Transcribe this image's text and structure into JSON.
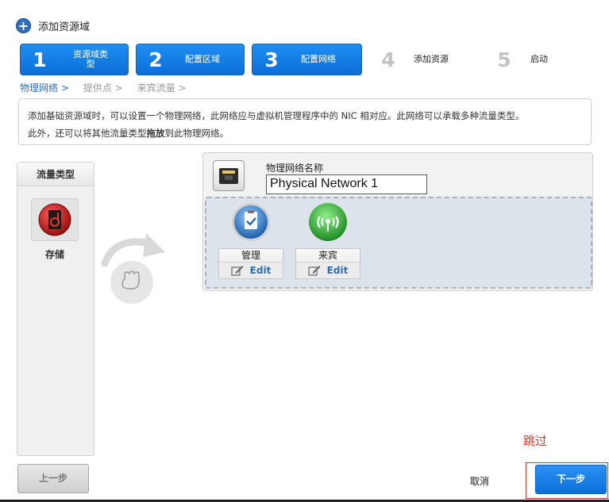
{
  "dialog": {
    "title": "添加资源域"
  },
  "steps": [
    {
      "num": "1",
      "label": "资源域类型",
      "label_line1": "资源域类",
      "label_line2": "型",
      "active": true
    },
    {
      "num": "2",
      "label": "配置区域",
      "active": true
    },
    {
      "num": "3",
      "label": "配置网络",
      "active": true
    },
    {
      "num": "4",
      "label": "添加资源",
      "active": false
    },
    {
      "num": "5",
      "label": "启动",
      "active": false
    }
  ],
  "breadcrumb": [
    {
      "label": "物理网络 >",
      "current": true
    },
    {
      "label": "提供点 >",
      "current": false
    },
    {
      "label": "来宾流量 >",
      "current": false
    }
  ],
  "info": {
    "line1": "添加基础资源域时，可以设置一个物理网络，此网络应与虚拟机管理程序中的 NIC 相对应。此网络可以承载多种流量类型。",
    "line2_prefix": "此外，还可以将其他流量类型",
    "line2_bold": "拖放",
    "line2_suffix": "到此物理网络。"
  },
  "traffic_panel": {
    "header": "流量类型",
    "items": [
      {
        "label": "存储",
        "icon": "storage-icon"
      }
    ]
  },
  "network": {
    "name_label": "物理网络名称",
    "name_value": "Physical Network 1",
    "traffic_types": [
      {
        "label": "管理",
        "edit": "Edit",
        "icon": "management-icon"
      },
      {
        "label": "来宾",
        "edit": "Edit",
        "icon": "guest-icon"
      }
    ]
  },
  "footer": {
    "skip": "跳过",
    "prev": "上一步",
    "cancel": "取消",
    "next": "下一步"
  },
  "colors": {
    "accent": "#0a6fd6",
    "skip": "#e0322a",
    "dropzone": "#dde3ea"
  }
}
